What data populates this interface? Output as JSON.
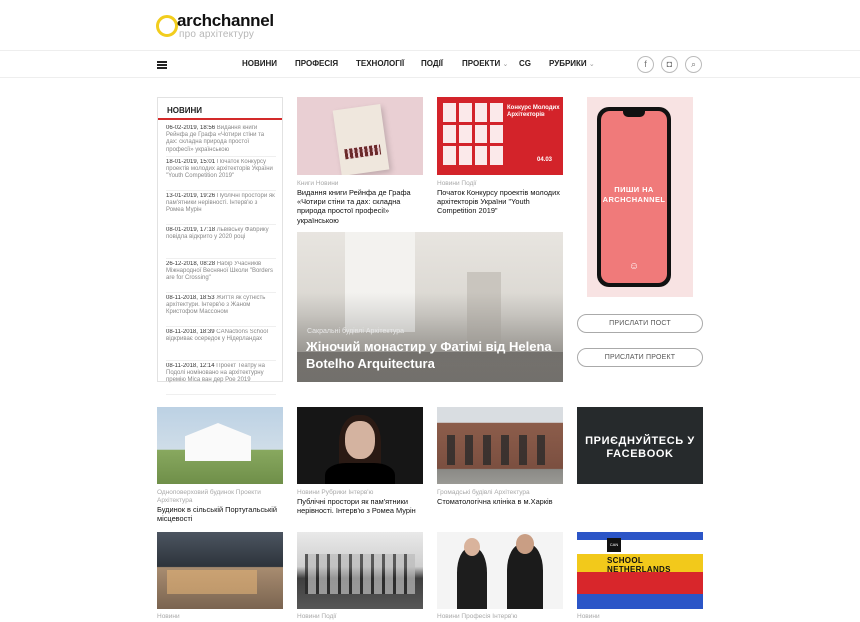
{
  "header": {
    "logo_name": "archchannel",
    "logo_sub": "про архітектуру"
  },
  "nav": {
    "items": [
      "НОВИНИ",
      "ПРОФЕСІЯ",
      "ТЕХНОЛОГІЇ",
      "ПОДІЇ",
      "ПРОЕКТИ",
      "CG",
      "РУБРИКИ"
    ],
    "social_icons": [
      "facebook-icon",
      "instagram-icon",
      "search-icon"
    ]
  },
  "newsbox": {
    "title": "НОВИНИ",
    "items": [
      {
        "date": "06-02-2019, 18:56",
        "text": "Видання книги Рейнфа де Графа «Чотири стіни та дах: складна природа простої професії» українською"
      },
      {
        "date": "18-01-2019, 15:01",
        "text": "Початок Конкурсу проектів молодих архітекторів України \"Youth Competition 2019\""
      },
      {
        "date": "13-01-2019, 19:26",
        "text": "Публічні простори як пам'ятники нерівності. Інтерв'ю з Ромеа Мурін"
      },
      {
        "date": "08-01-2019, 17:18",
        "text": "Львівську Фабрику повідла відкрито у 2020 році"
      },
      {
        "date": "26-12-2018, 08:28",
        "text": "Набір Учасників Міжнародної Весняної Школи \"Borders are for Crossing\""
      },
      {
        "date": "08-11-2018, 18:53",
        "text": "Життя як сутність архітектури. Інтерв'ю з Жаном Кристофом Массоном"
      },
      {
        "date": "08-11-2018, 18:39",
        "text": "CANactions School відкриває осередок у Нідерландах"
      },
      {
        "date": "08-11-2018, 12:14",
        "text": "Проект Театру на Подолі номіновано на архітектурну премію Міса ван дер Рое 2019"
      }
    ]
  },
  "featured": {
    "book": {
      "category": "Книги Новини",
      "title": "Видання книги Рейнфа де Графа «Чотири стіни та дах: складна природа простої професії» українською"
    },
    "contest": {
      "category": "Новини Події",
      "title": "Початок Конкурсу проектів молодих архітекторів України \"Youth Competition 2019\"",
      "poster_title": "Конкурс Молодих Архітекторів",
      "poster_date": "04.03"
    },
    "hero": {
      "category": "Сакральні будівлі Архітектура",
      "title": "Жіночий монастир у Фатімі від Helena Botelho Arquitectura"
    }
  },
  "sidebar": {
    "ad_text": "ПИШИ НА ARCHCHANNEL",
    "ad_smile": "☺",
    "submit_post": "ПРИСЛАТИ ПОСТ",
    "submit_project": "ПРИСЛАТИ ПРОЕКТ"
  },
  "grid": [
    {
      "category": "Одноповерховий будинок Проекти Архітектура",
      "title": "Будинок в сільській Португальській місцевості"
    },
    {
      "category": "Новини Рубрики Інтерв'ю",
      "title": "Публічні простори як пам'ятники нерівності. Інтерв'ю з Ромеа Мурін"
    },
    {
      "category": "Громадські будівлі Архітектура",
      "title": "Стоматологічна клініка в м.Харків"
    },
    {
      "fb_text": "ПРИЄДНУЙТЕСЬ У FACEBOOK"
    },
    {
      "category": "Новини",
      "title": ""
    },
    {
      "category": "Новини Події",
      "title": ""
    },
    {
      "category": "Новини Професія Інтерв'ю",
      "title": ""
    },
    {
      "category": "Новини",
      "title": "",
      "badge": "CAN",
      "flag_text": "SCHOOL NETHERLANDS"
    }
  ]
}
